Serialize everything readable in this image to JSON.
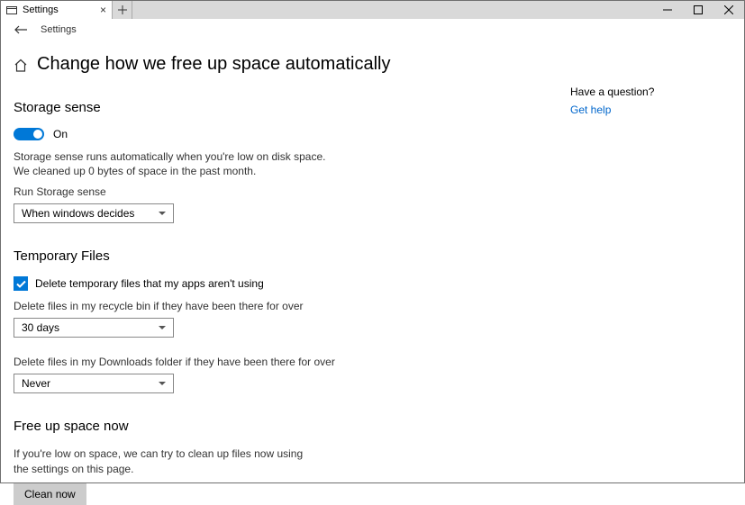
{
  "window": {
    "tab_label": "Settings",
    "nav_label": "Settings"
  },
  "page": {
    "title": "Change how we free up space automatically"
  },
  "storage_sense": {
    "heading": "Storage sense",
    "toggle_state": "On",
    "desc_line1": "Storage sense runs automatically when you're low on disk space.",
    "desc_line2": "We cleaned up 0 bytes of space in the past month.",
    "run_label": "Run Storage sense",
    "run_value": "When windows decides"
  },
  "temp_files": {
    "heading": "Temporary Files",
    "checkbox_label": "Delete temporary files that my apps aren't using",
    "recycle_label": "Delete files in my recycle bin if they have been there for over",
    "recycle_value": "30 days",
    "downloads_label": "Delete files in my Downloads folder if they have been there for over",
    "downloads_value": "Never"
  },
  "free_up": {
    "heading": "Free up space now",
    "desc": "If you're low on space, we can try to clean up files now using the settings on this page.",
    "button": "Clean now"
  },
  "aside": {
    "question": "Have a question?",
    "help_link": "Get help"
  }
}
